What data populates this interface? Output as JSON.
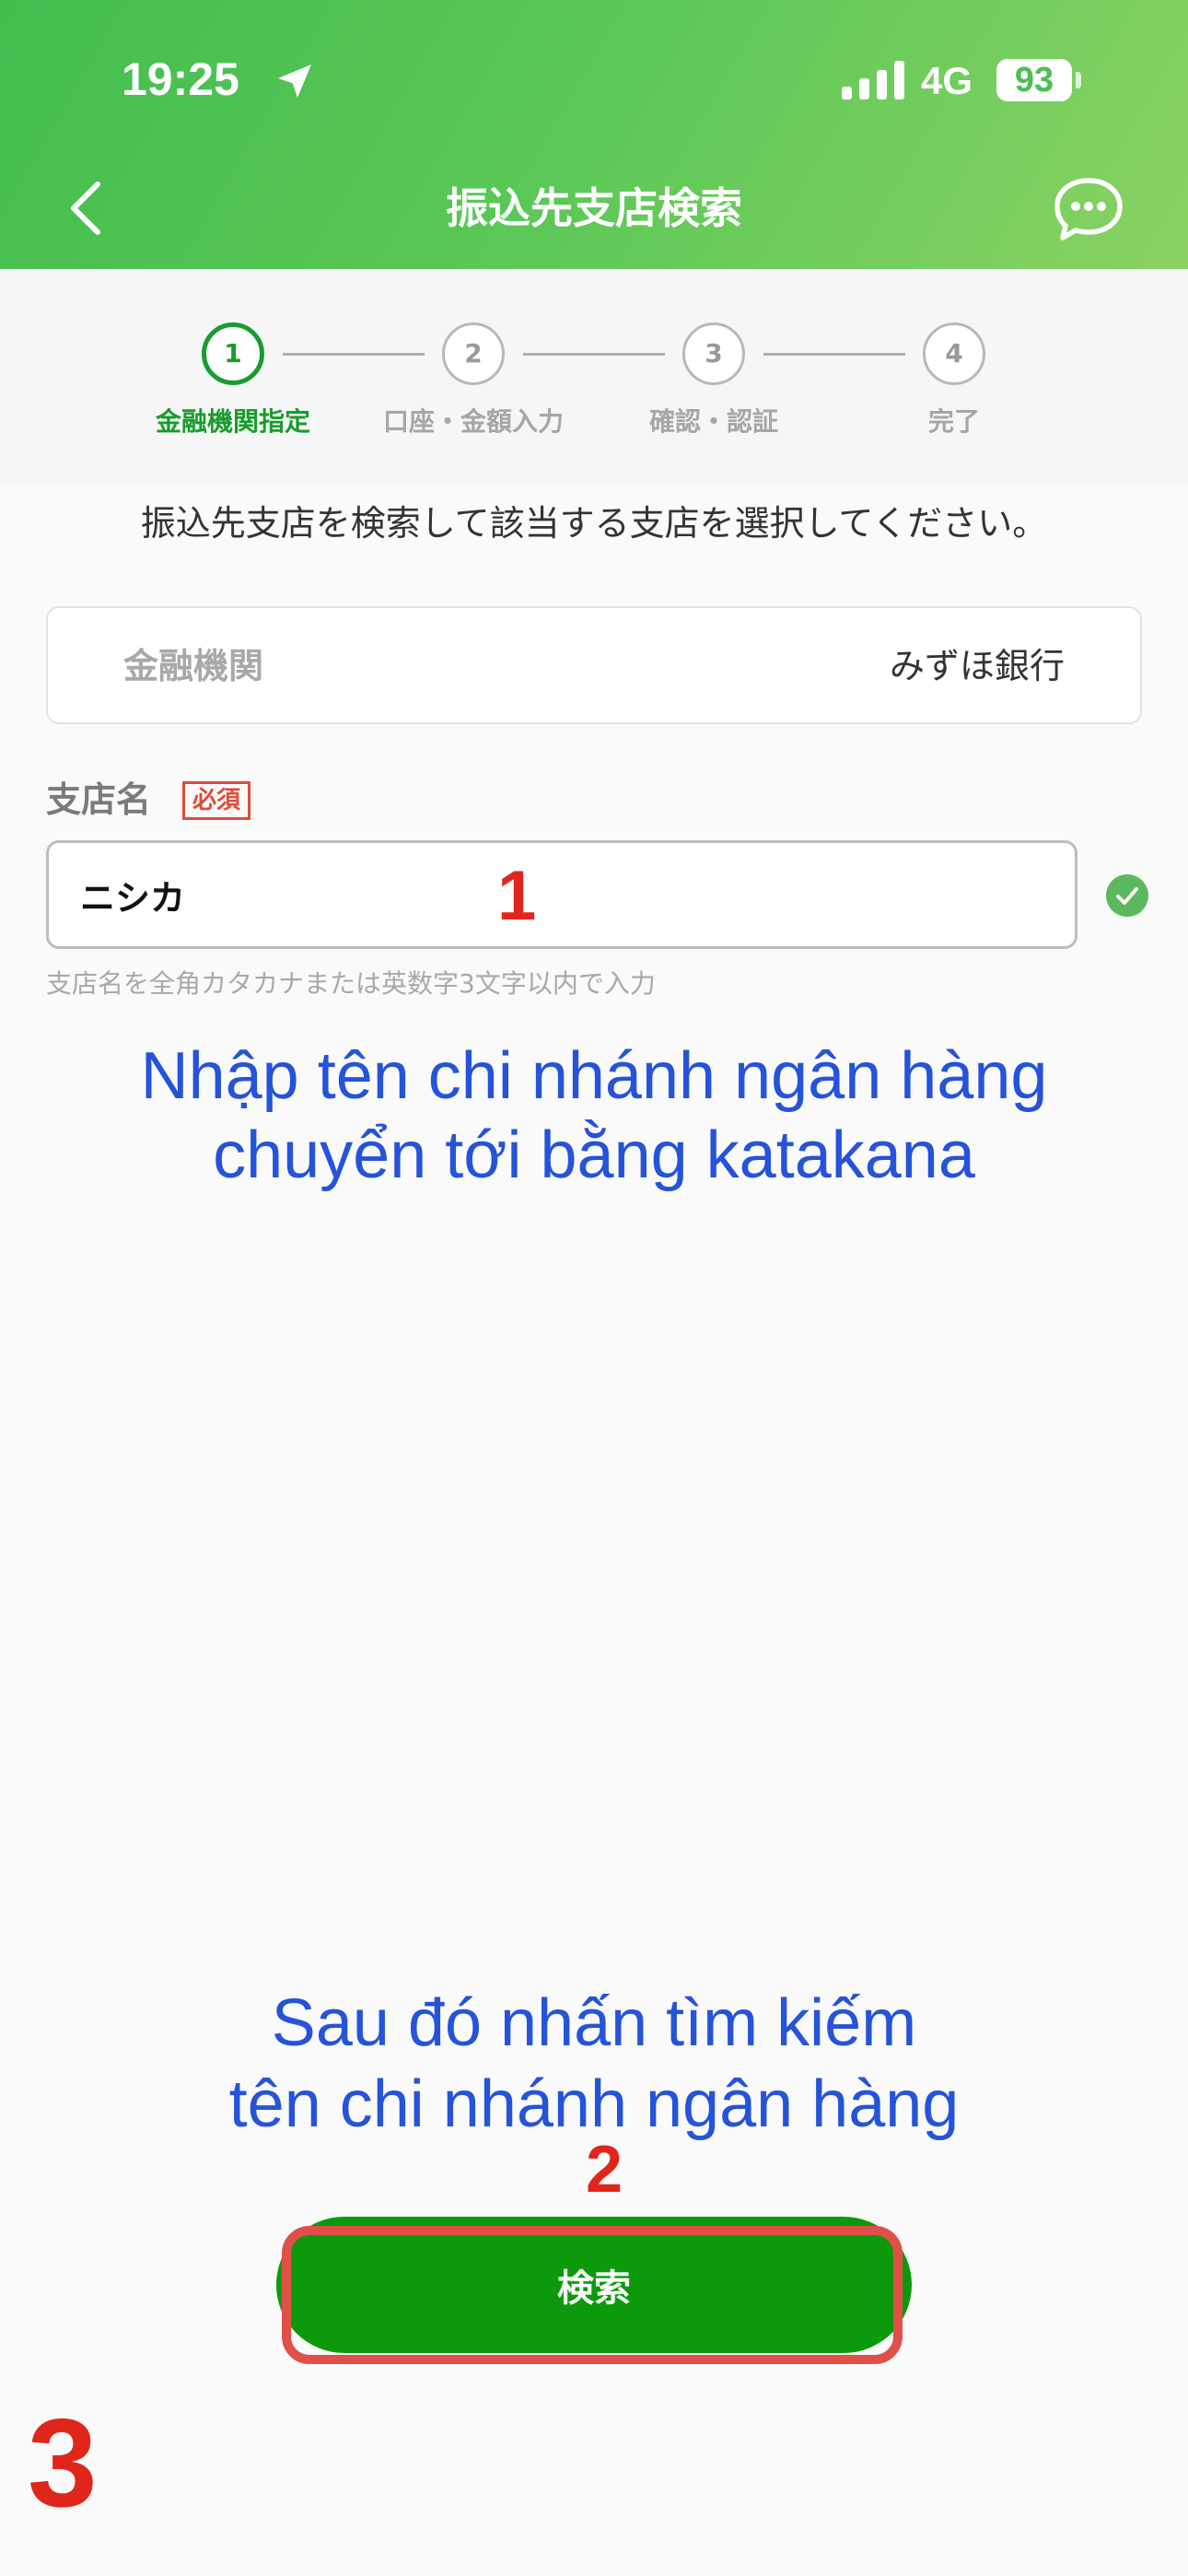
{
  "status_bar": {
    "time": "19:25",
    "network": "4G",
    "battery": "93"
  },
  "nav": {
    "title": "振込先支店検索"
  },
  "stepper": {
    "steps": [
      {
        "number": "1",
        "label": "金融機関指定"
      },
      {
        "number": "2",
        "label": "口座・金額入力"
      },
      {
        "number": "3",
        "label": "確認・認証"
      },
      {
        "number": "4",
        "label": "完了"
      }
    ]
  },
  "main": {
    "instruction": "振込先支店を検索して該当する支店を選択してください。",
    "bank_label": "金融機関",
    "bank_value": "みずほ銀行",
    "branch_label": "支店名",
    "required_badge": "必須",
    "branch_input_value": "ニシカ",
    "hint": "支店名を全角カタカナまたは英数字3文字以内で入力",
    "search_button": "検索"
  },
  "annotations": {
    "num1": "1",
    "num2": "2",
    "num3": "3",
    "note1_line1": "Nhập tên chi nhánh ngân hàng",
    "note1_line2": "chuyển tới bằng katakana",
    "note2_line1": "Sau đó nhấn tìm kiếm",
    "note2_line2": "tên chi nhánh ngân hàng"
  },
  "colors": {
    "header_start": "#43bd4f",
    "header_end": "#8ad263",
    "accent_green": "#1a9b2e",
    "button_green": "#0c9a0c",
    "required_red": "#e04b3a",
    "annotation_red": "#e0261a",
    "annotation_blue": "#2553d9"
  },
  "icons": {
    "location": "location-arrow-icon",
    "signal": "signal-bars-icon",
    "back": "chevron-left-icon",
    "chat": "chat-bubble-icon",
    "check": "check-circle-icon"
  }
}
